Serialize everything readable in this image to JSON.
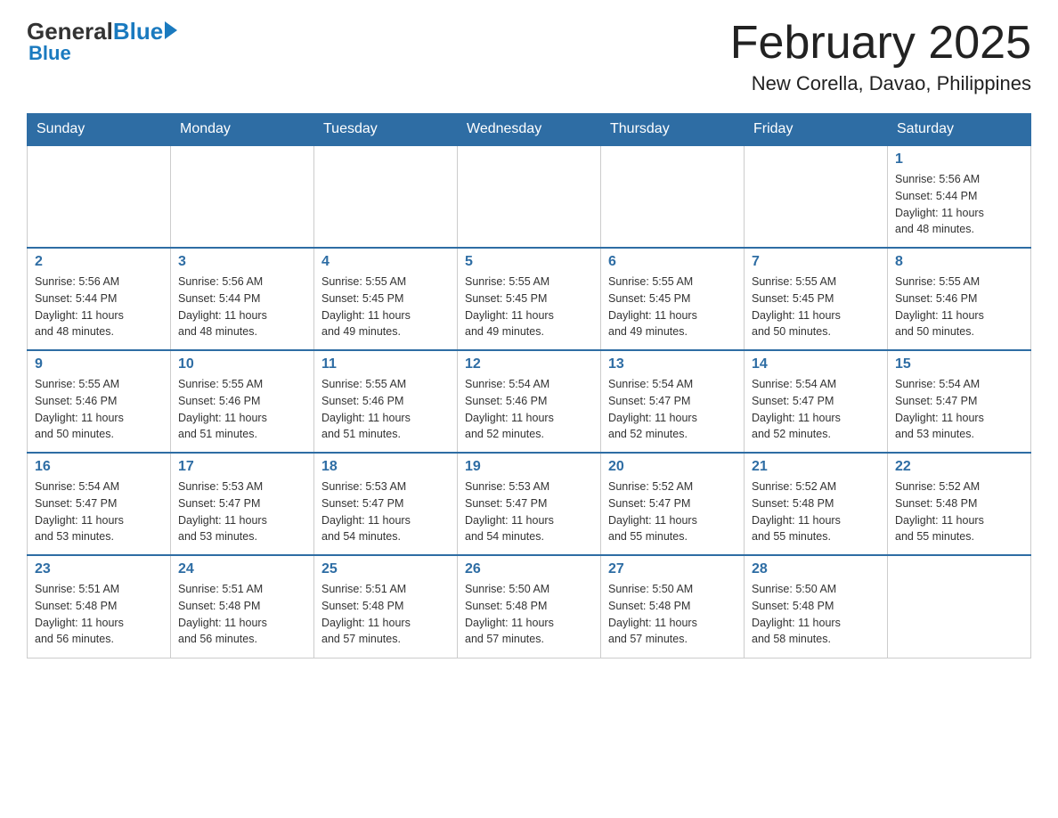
{
  "header": {
    "logo_general": "General",
    "logo_blue": "Blue",
    "title": "February 2025",
    "subtitle": "New Corella, Davao, Philippines"
  },
  "days_of_week": [
    "Sunday",
    "Monday",
    "Tuesday",
    "Wednesday",
    "Thursday",
    "Friday",
    "Saturday"
  ],
  "weeks": [
    [
      {
        "day": "",
        "info": ""
      },
      {
        "day": "",
        "info": ""
      },
      {
        "day": "",
        "info": ""
      },
      {
        "day": "",
        "info": ""
      },
      {
        "day": "",
        "info": ""
      },
      {
        "day": "",
        "info": ""
      },
      {
        "day": "1",
        "info": "Sunrise: 5:56 AM\nSunset: 5:44 PM\nDaylight: 11 hours\nand 48 minutes."
      }
    ],
    [
      {
        "day": "2",
        "info": "Sunrise: 5:56 AM\nSunset: 5:44 PM\nDaylight: 11 hours\nand 48 minutes."
      },
      {
        "day": "3",
        "info": "Sunrise: 5:56 AM\nSunset: 5:44 PM\nDaylight: 11 hours\nand 48 minutes."
      },
      {
        "day": "4",
        "info": "Sunrise: 5:55 AM\nSunset: 5:45 PM\nDaylight: 11 hours\nand 49 minutes."
      },
      {
        "day": "5",
        "info": "Sunrise: 5:55 AM\nSunset: 5:45 PM\nDaylight: 11 hours\nand 49 minutes."
      },
      {
        "day": "6",
        "info": "Sunrise: 5:55 AM\nSunset: 5:45 PM\nDaylight: 11 hours\nand 49 minutes."
      },
      {
        "day": "7",
        "info": "Sunrise: 5:55 AM\nSunset: 5:45 PM\nDaylight: 11 hours\nand 50 minutes."
      },
      {
        "day": "8",
        "info": "Sunrise: 5:55 AM\nSunset: 5:46 PM\nDaylight: 11 hours\nand 50 minutes."
      }
    ],
    [
      {
        "day": "9",
        "info": "Sunrise: 5:55 AM\nSunset: 5:46 PM\nDaylight: 11 hours\nand 50 minutes."
      },
      {
        "day": "10",
        "info": "Sunrise: 5:55 AM\nSunset: 5:46 PM\nDaylight: 11 hours\nand 51 minutes."
      },
      {
        "day": "11",
        "info": "Sunrise: 5:55 AM\nSunset: 5:46 PM\nDaylight: 11 hours\nand 51 minutes."
      },
      {
        "day": "12",
        "info": "Sunrise: 5:54 AM\nSunset: 5:46 PM\nDaylight: 11 hours\nand 52 minutes."
      },
      {
        "day": "13",
        "info": "Sunrise: 5:54 AM\nSunset: 5:47 PM\nDaylight: 11 hours\nand 52 minutes."
      },
      {
        "day": "14",
        "info": "Sunrise: 5:54 AM\nSunset: 5:47 PM\nDaylight: 11 hours\nand 52 minutes."
      },
      {
        "day": "15",
        "info": "Sunrise: 5:54 AM\nSunset: 5:47 PM\nDaylight: 11 hours\nand 53 minutes."
      }
    ],
    [
      {
        "day": "16",
        "info": "Sunrise: 5:54 AM\nSunset: 5:47 PM\nDaylight: 11 hours\nand 53 minutes."
      },
      {
        "day": "17",
        "info": "Sunrise: 5:53 AM\nSunset: 5:47 PM\nDaylight: 11 hours\nand 53 minutes."
      },
      {
        "day": "18",
        "info": "Sunrise: 5:53 AM\nSunset: 5:47 PM\nDaylight: 11 hours\nand 54 minutes."
      },
      {
        "day": "19",
        "info": "Sunrise: 5:53 AM\nSunset: 5:47 PM\nDaylight: 11 hours\nand 54 minutes."
      },
      {
        "day": "20",
        "info": "Sunrise: 5:52 AM\nSunset: 5:47 PM\nDaylight: 11 hours\nand 55 minutes."
      },
      {
        "day": "21",
        "info": "Sunrise: 5:52 AM\nSunset: 5:48 PM\nDaylight: 11 hours\nand 55 minutes."
      },
      {
        "day": "22",
        "info": "Sunrise: 5:52 AM\nSunset: 5:48 PM\nDaylight: 11 hours\nand 55 minutes."
      }
    ],
    [
      {
        "day": "23",
        "info": "Sunrise: 5:51 AM\nSunset: 5:48 PM\nDaylight: 11 hours\nand 56 minutes."
      },
      {
        "day": "24",
        "info": "Sunrise: 5:51 AM\nSunset: 5:48 PM\nDaylight: 11 hours\nand 56 minutes."
      },
      {
        "day": "25",
        "info": "Sunrise: 5:51 AM\nSunset: 5:48 PM\nDaylight: 11 hours\nand 57 minutes."
      },
      {
        "day": "26",
        "info": "Sunrise: 5:50 AM\nSunset: 5:48 PM\nDaylight: 11 hours\nand 57 minutes."
      },
      {
        "day": "27",
        "info": "Sunrise: 5:50 AM\nSunset: 5:48 PM\nDaylight: 11 hours\nand 57 minutes."
      },
      {
        "day": "28",
        "info": "Sunrise: 5:50 AM\nSunset: 5:48 PM\nDaylight: 11 hours\nand 58 minutes."
      },
      {
        "day": "",
        "info": ""
      }
    ]
  ]
}
